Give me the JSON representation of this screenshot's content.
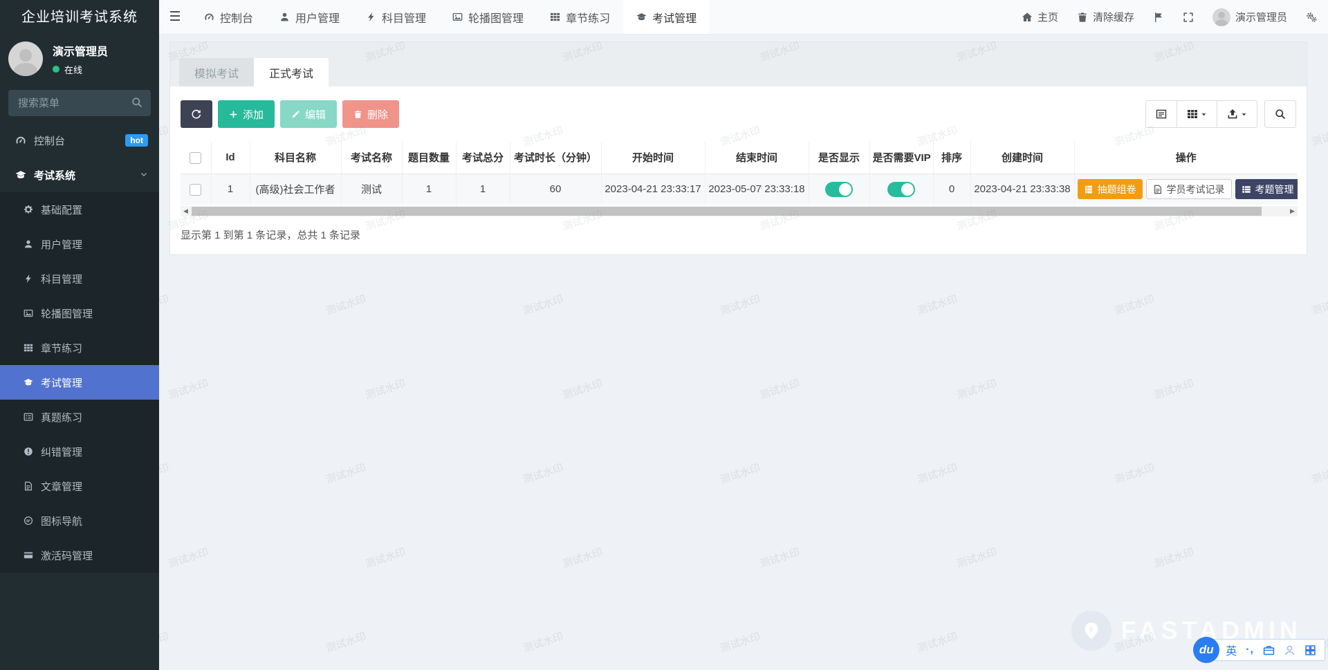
{
  "app_title": "企业培训考试系统",
  "user": {
    "name": "演示管理员",
    "status": "在线"
  },
  "sidebar": {
    "search_placeholder": "搜索菜单",
    "items": [
      {
        "label": "控制台",
        "icon": "gauge-icon",
        "badge": "hot"
      },
      {
        "label": "考试系统",
        "icon": "graduation-cap-icon",
        "expanded": true
      }
    ],
    "subitems": [
      {
        "label": "基础配置",
        "icon": "gear-icon"
      },
      {
        "label": "用户管理",
        "icon": "user-icon"
      },
      {
        "label": "科目管理",
        "icon": "bolt-icon"
      },
      {
        "label": "轮播图管理",
        "icon": "image-icon"
      },
      {
        "label": "章节练习",
        "icon": "grid-icon"
      },
      {
        "label": "考试管理",
        "icon": "graduation-cap-icon",
        "active": true
      },
      {
        "label": "真题练习",
        "icon": "list-alt-icon"
      },
      {
        "label": "纠错管理",
        "icon": "exclamation-icon"
      },
      {
        "label": "文章管理",
        "icon": "file-text-icon"
      },
      {
        "label": "图标导航",
        "icon": "comments-icon"
      },
      {
        "label": "激活码管理",
        "icon": "credit-card-icon"
      }
    ]
  },
  "topbar": {
    "items": [
      {
        "label": "控制台"
      },
      {
        "label": "用户管理"
      },
      {
        "label": "科目管理"
      },
      {
        "label": "轮播图管理"
      },
      {
        "label": "章节练习"
      },
      {
        "label": "考试管理",
        "active": true
      }
    ],
    "right": {
      "home": "主页",
      "clear_cache": "清除缓存",
      "username": "演示管理员"
    }
  },
  "tabs": [
    {
      "label": "模拟考试"
    },
    {
      "label": "正式考试",
      "active": true
    }
  ],
  "toolbar": {
    "add": "添加",
    "edit": "编辑",
    "delete": "删除"
  },
  "table": {
    "headers": [
      "Id",
      "科目名称",
      "考试名称",
      "题目数量",
      "考试总分",
      "考试时长（分钟）",
      "开始时间",
      "结束时间",
      "是否显示",
      "是否需要VIP",
      "排序",
      "创建时间",
      "操作"
    ],
    "rows": [
      {
        "id": "1",
        "subject": "(高级)社会工作者",
        "exam_name": "测试",
        "question_count": "1",
        "total_score": "1",
        "duration": "60",
        "start_time": "2023-04-21 23:33:17",
        "end_time": "2023-05-07 23:33:18",
        "show_enabled": true,
        "vip_enabled": true,
        "sort": "0",
        "create_time": "2023-04-21 23:33:38"
      }
    ],
    "row_actions": {
      "extract": "抽题组卷",
      "records": "学员考试记录",
      "questions": "考题管理"
    }
  },
  "pagination_text": "显示第 1 到第 1 条记录，总共 1 条记录",
  "watermark_text": "测试水印",
  "brand_text": "FASTADMIN",
  "ime": {
    "logo": "du",
    "lang": "英",
    "punct": "·,"
  },
  "colors": {
    "sidebar_bg": "#222d32",
    "submenu_bg": "#1c2529",
    "active_blue": "#5272cf",
    "badge_blue": "#2d9cf0",
    "success_green": "#26b99a",
    "toggle_green": "#26bc9c",
    "warning_orange": "#f39c12",
    "danger_red": "#e74c3c",
    "dark_navy": "#3d4465"
  }
}
